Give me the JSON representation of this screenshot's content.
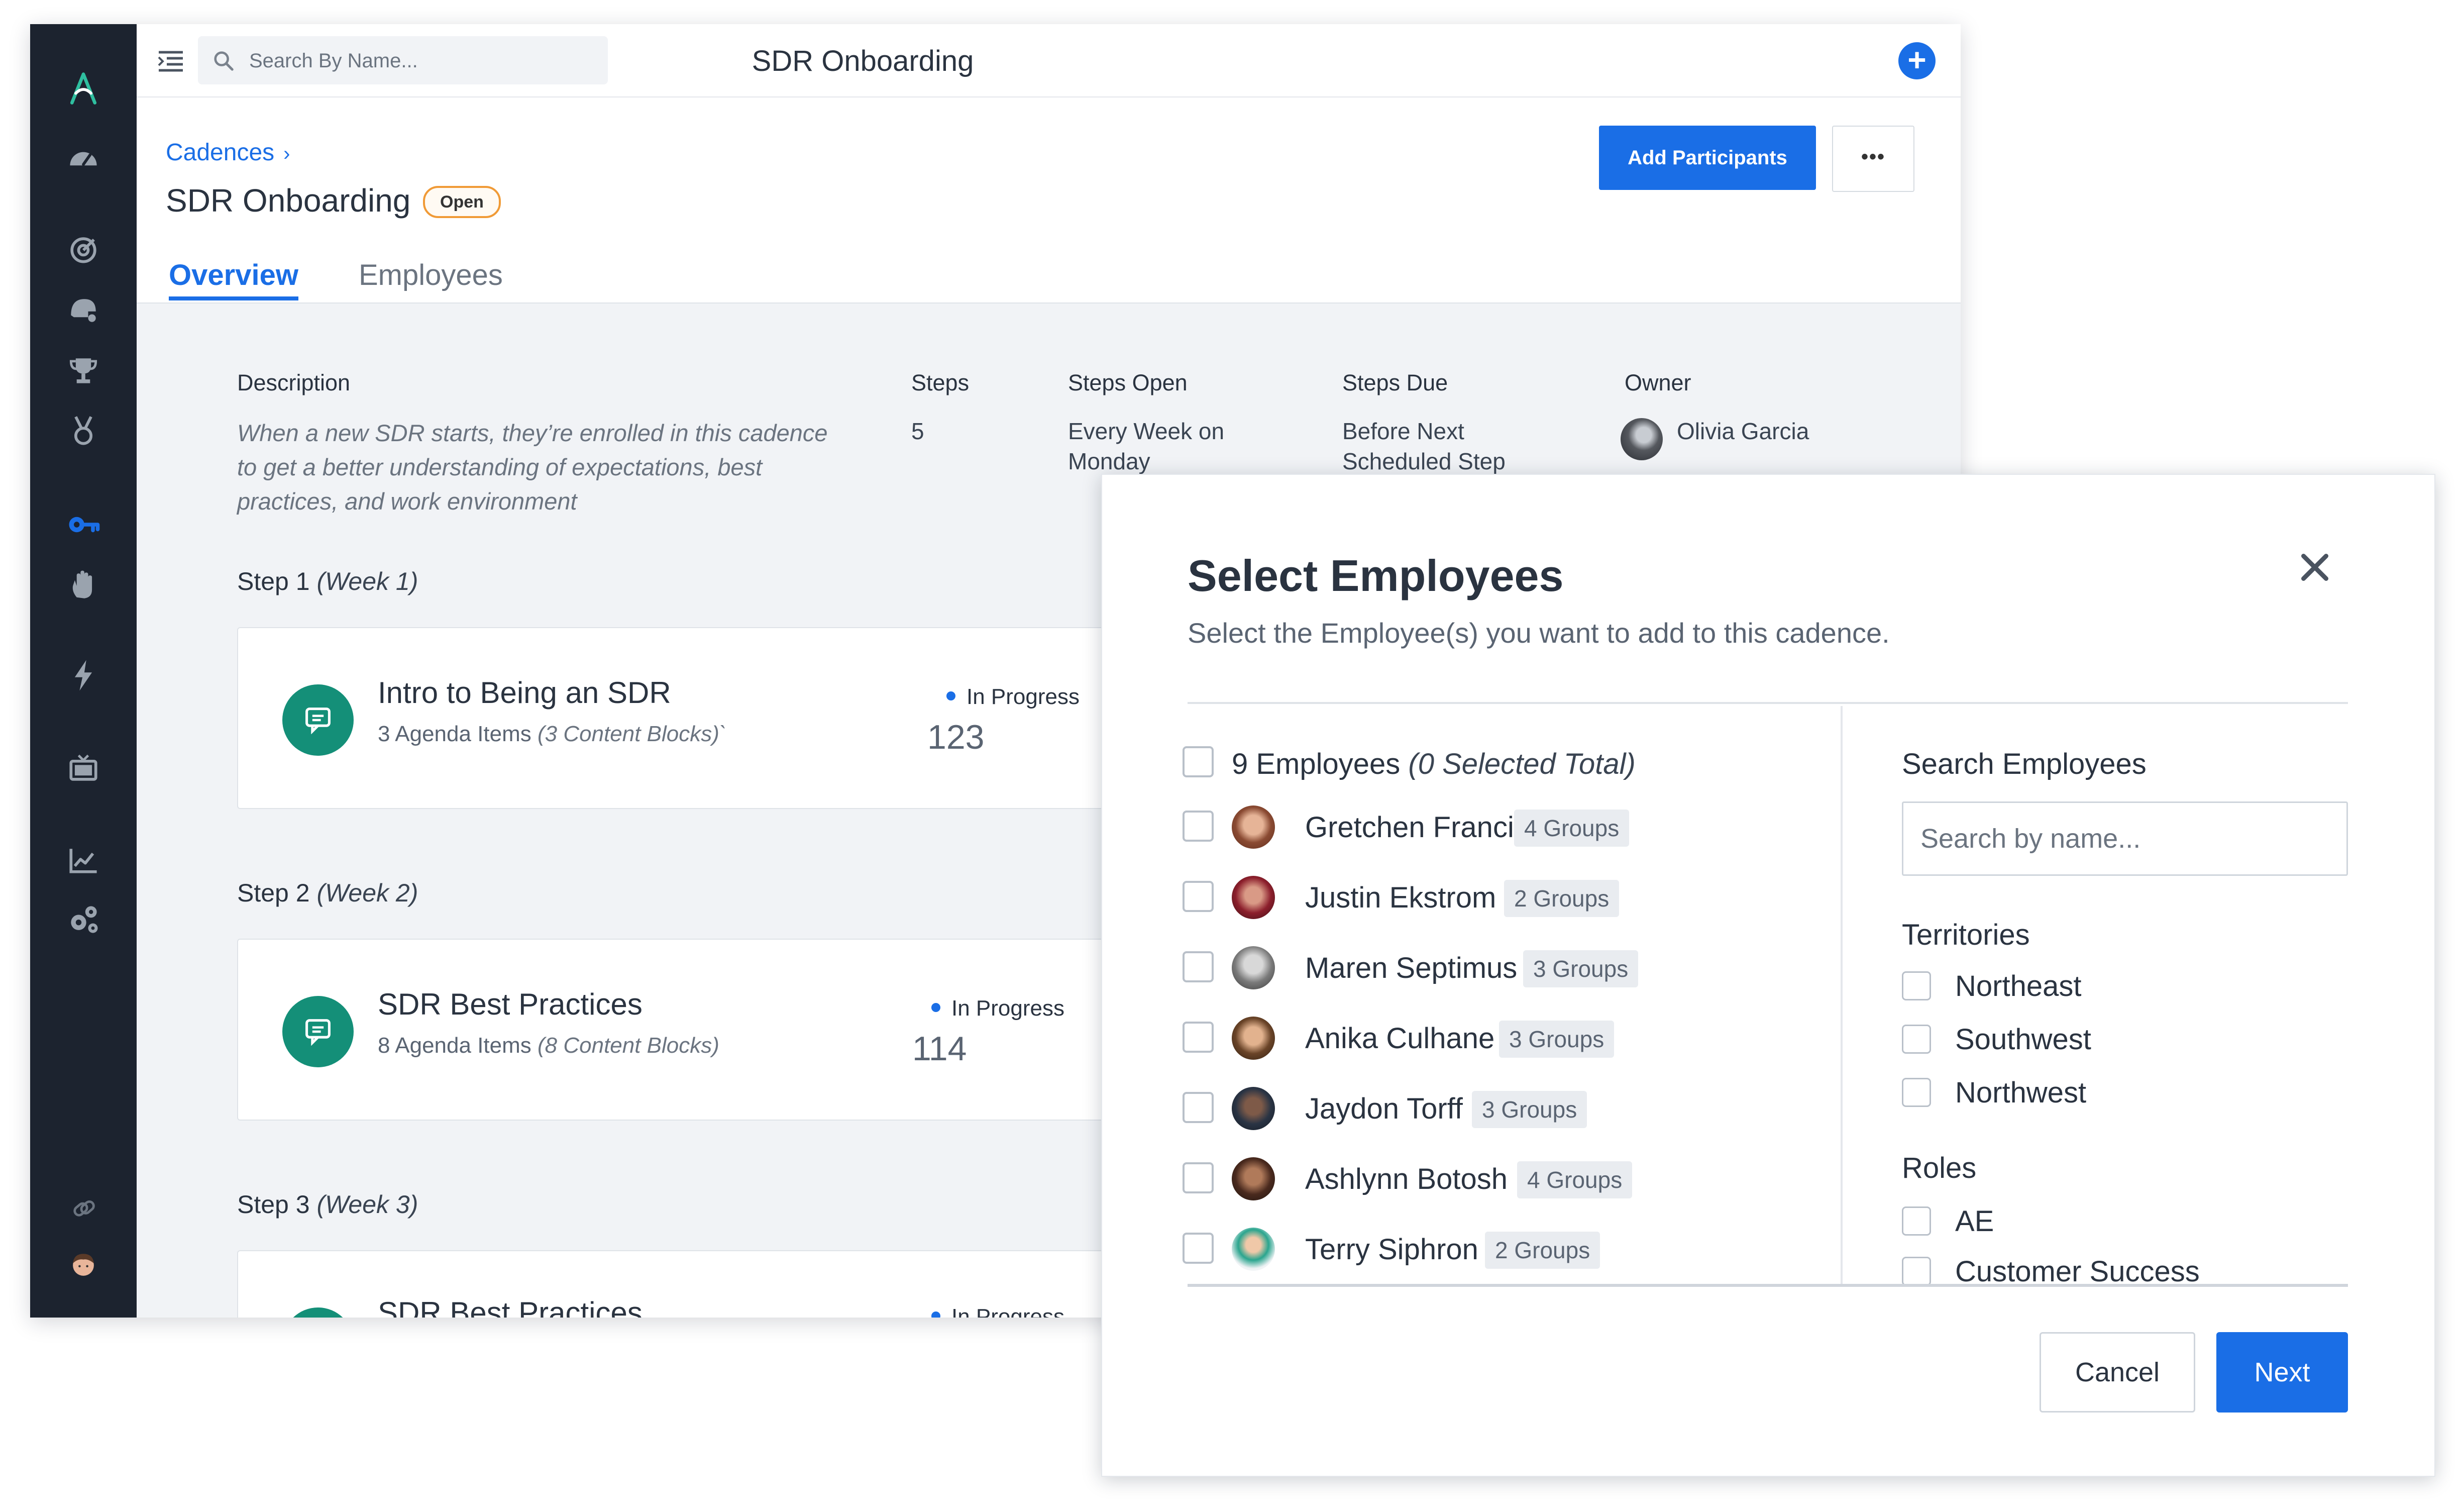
{
  "topbar": {
    "search_placeholder": "Search By Name...",
    "title": "SDR Onboarding",
    "plus_label": "+"
  },
  "header": {
    "breadcrumb": "Cadences",
    "breadcrumb_chevron": "›",
    "title": "SDR Onboarding",
    "status": "Open",
    "add_participants": "Add Participants",
    "more": "•••",
    "tabs": [
      "Overview",
      "Employees"
    ]
  },
  "details": {
    "description_label": "Description",
    "description": "When a new SDR starts, they’re enrolled in this cadence to get a better understanding of expectations, best practices, and work environment",
    "steps_label": "Steps",
    "steps": "5",
    "steps_open_label": "Steps Open",
    "steps_open": "Every Week on Monday",
    "steps_due_label": "Steps Due",
    "steps_due": "Before Next Scheduled Step",
    "owner_label": "Owner",
    "owner": "Olivia Garcia"
  },
  "steps": [
    {
      "label": "Step 1",
      "week": "(Week 1)",
      "title": "Intro to Being an SDR",
      "items": "3 Agenda Items",
      "blocks": "(3 Content Blocks)`",
      "status": "In Progress",
      "count": "123"
    },
    {
      "label": "Step 2",
      "week": "(Week 2)",
      "title": "SDR Best Practices",
      "items": "8 Agenda Items",
      "blocks": "(8 Content Blocks)",
      "status": "In Progress",
      "count": "114"
    },
    {
      "label": "Step 3",
      "week": "(Week 3)",
      "title": "SDR Best Practices",
      "status": "In Progress"
    }
  ],
  "modal": {
    "title": "Select Employees",
    "subtitle": "Select the Employee(s) you want to add to this cadence.",
    "employees_count": "9 Employees",
    "selected_total": "(0 Selected Total)",
    "employees": [
      {
        "name": "Gretchen Franci",
        "groups": "4 Groups"
      },
      {
        "name": "Justin Ekstrom",
        "groups": "2 Groups"
      },
      {
        "name": "Maren Septimus",
        "groups": "3 Groups"
      },
      {
        "name": "Anika Culhane",
        "groups": "3 Groups"
      },
      {
        "name": "Jaydon Torff",
        "groups": "3 Groups"
      },
      {
        "name": "Ashlynn Botosh",
        "groups": "4 Groups"
      },
      {
        "name": "Terry Siphron",
        "groups": "2 Groups"
      }
    ],
    "search_label": "Search Employees",
    "search_placeholder": "Search by name...",
    "territories_label": "Territories",
    "territories": [
      "Northeast",
      "Southwest",
      "Northwest"
    ],
    "roles_label": "Roles",
    "roles": [
      "AE",
      "Customer Success"
    ],
    "cancel": "Cancel",
    "next": "Next"
  },
  "colors": {
    "primary": "#1a6ee6",
    "sidebar": "#1c232f",
    "step_icon": "#148f78",
    "badge_border": "#f09a36"
  },
  "icons": [
    "logo-icon",
    "dashboard-icon",
    "target-icon",
    "helmet-icon",
    "trophy-icon",
    "medal-icon",
    "key-icon",
    "hand-icon",
    "bolt-icon",
    "tv-icon",
    "chart-icon",
    "gears-icon",
    "link-icon",
    "search-icon",
    "menu-icon",
    "close-icon",
    "chat-icon"
  ]
}
